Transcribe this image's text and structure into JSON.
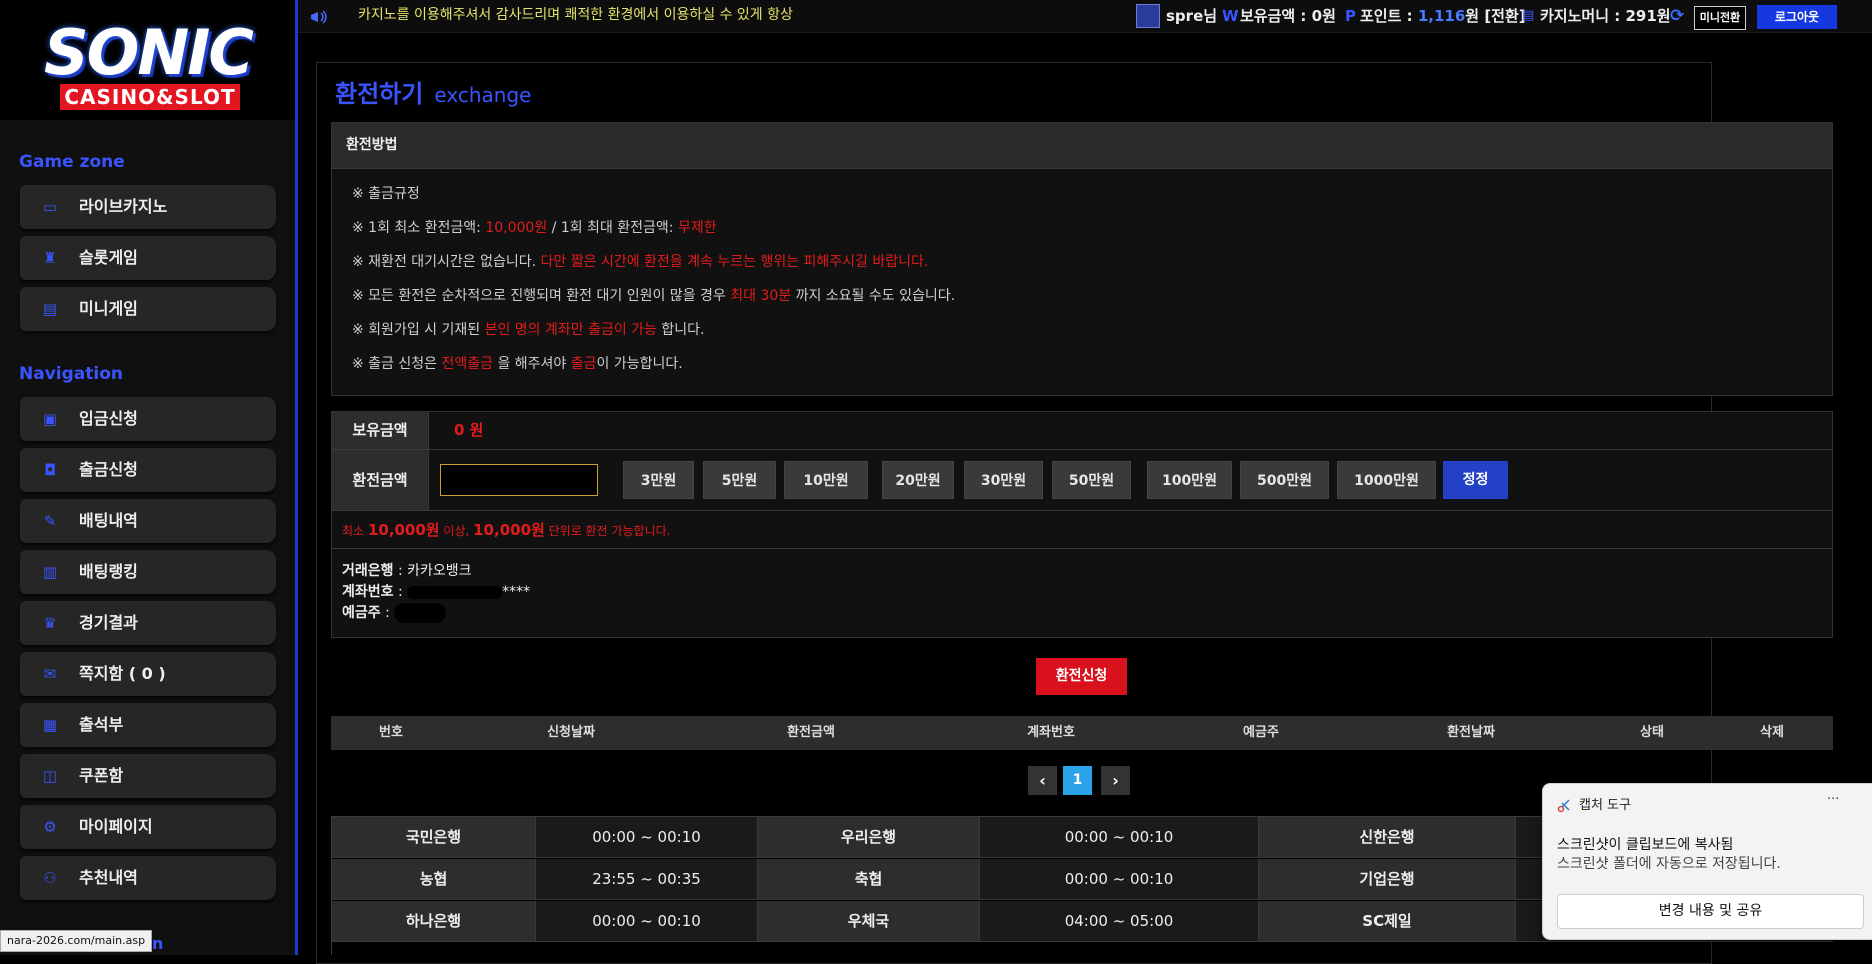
{
  "brand": {
    "logo_main": "SONIC",
    "logo_sub": "CASINO&SLOT"
  },
  "sidebar": {
    "game_heading": "Game zone",
    "game_items": [
      {
        "label": "라이브카지노",
        "icon": "card-icon"
      },
      {
        "label": "슬롯게임",
        "icon": "slot-icon"
      },
      {
        "label": "미니게임",
        "icon": "mini-icon"
      }
    ],
    "nav_heading": "Navigation",
    "nav_items": [
      {
        "label": "입금신청",
        "icon": "deposit-icon"
      },
      {
        "label": "출금신청",
        "icon": "wallet-icon"
      },
      {
        "label": "배팅내역",
        "icon": "history-icon"
      },
      {
        "label": "배팅랭킹",
        "icon": "ranking-icon"
      },
      {
        "label": "경기결과",
        "icon": "trophy-icon"
      },
      {
        "label": "쪽지함 ( 0 )",
        "icon": "message-icon"
      },
      {
        "label": "출석부",
        "icon": "calendar-icon"
      },
      {
        "label": "쿠폰함",
        "icon": "coupon-icon"
      },
      {
        "label": "마이페이지",
        "icon": "gear-icon"
      },
      {
        "label": "추천내역",
        "icon": "user-plus-icon"
      }
    ],
    "cut_heading": "on"
  },
  "topbar": {
    "marquee": "카지노를 이용해주셔서 감사드리며 쾌적한 환경에서 이용하실 수 있게 항상",
    "username": "spre님",
    "balance_label": "보유금액 : 0원",
    "points_label": "포인트 : ",
    "points_value": "1,116",
    "points_suffix": "원 [전환]",
    "casino_label": "카지노머니 : 291원",
    "mini_switch": "미니전환",
    "logout": "로그아웃"
  },
  "page": {
    "title": "환전하기",
    "subtitle": "exchange"
  },
  "method": {
    "heading": "환전방법",
    "rules": [
      {
        "parts": [
          {
            "t": "※ 출금규정",
            "red": false
          }
        ]
      },
      {
        "parts": [
          {
            "t": "※ 1회 최소 환전금액: ",
            "red": false
          },
          {
            "t": "10,000원",
            "red": true
          },
          {
            "t": " / 1회 최대 환전금액: ",
            "red": false
          },
          {
            "t": "무제한",
            "red": true
          }
        ]
      },
      {
        "parts": [
          {
            "t": "※ 재환전 대기시간은 없습니다. ",
            "red": false
          },
          {
            "t": "다만 짧은 시간에 환전을 계속 누르는 행위는 피해주시길 바랍니다.",
            "red": true
          }
        ]
      },
      {
        "parts": [
          {
            "t": "※ 모든 환전은 순차적으로 진행되며 환전 대기 인원이 많을 경우 ",
            "red": false
          },
          {
            "t": "최대 30분",
            "red": true
          },
          {
            "t": " 까지 소요될 수도 있습니다.",
            "red": false
          }
        ]
      },
      {
        "parts": [
          {
            "t": "※ 회원가입 시 기재된 ",
            "red": false
          },
          {
            "t": "본인 명의 계좌만 출금이 가능",
            "red": true
          },
          {
            "t": " 합니다.",
            "red": false
          }
        ]
      },
      {
        "parts": [
          {
            "t": "※ 출금 신청은 ",
            "red": false
          },
          {
            "t": "전액출금",
            "red": true
          },
          {
            "t": " 을 해주셔야 ",
            "red": false
          },
          {
            "t": "출금",
            "red": true
          },
          {
            "t": "이 가능합니다.",
            "red": false
          }
        ]
      }
    ]
  },
  "form": {
    "balance_label": "보유금액",
    "balance_value": "0 원",
    "amount_label": "환전금액",
    "amount_value": "",
    "amount_buttons": [
      "3만원",
      "5만원",
      "10만원",
      "20만원",
      "30만원",
      "50만원",
      "100만원",
      "500만원",
      "1000만원"
    ],
    "reset_button": "정정",
    "notice_prefix": "최소 ",
    "notice_min": "10,000원",
    "notice_mid": " 이상, ",
    "notice_unit": "10,000원",
    "notice_suffix": " 단위로 환전 가능합니다.",
    "bank_label": "거래은행",
    "bank_value": "카카오뱅크",
    "account_label": "계좌번호",
    "account_value": "****",
    "holder_label": "예금주",
    "holder_value": "",
    "submit": "환전신청"
  },
  "history": {
    "columns": [
      "번호",
      "신청날짜",
      "환전금액",
      "계좌번호",
      "예금주",
      "환전날짜",
      "상태",
      "삭제"
    ],
    "page": "1"
  },
  "banks": [
    {
      "name": "국민은행",
      "time": "00:00 ~ 00:10"
    },
    {
      "name": "우리은행",
      "time": "00:00 ~ 00:10"
    },
    {
      "name": "신한은행",
      "time": ""
    },
    {
      "name": "농협",
      "time": "23:55 ~ 00:35"
    },
    {
      "name": "축협",
      "time": "00:00 ~ 00:10"
    },
    {
      "name": "기업은행",
      "time": ""
    },
    {
      "name": "하나은행",
      "time": "00:00 ~ 00:10"
    },
    {
      "name": "우체국",
      "time": "04:00 ~ 05:00"
    },
    {
      "name": "SC제일",
      "time": ""
    }
  ],
  "status_url": "nara-2026.com/main.asp",
  "toast": {
    "app": "캡처 도구",
    "more": "···",
    "title": "스크린샷이 클립보드에 복사됨",
    "body": "스크린샷 폴더에 자동으로 저장됩니다.",
    "action": "변경 내용 및 공유"
  },
  "colors": {
    "accent": "#3a55ff",
    "danger": "#e21b1b",
    "submit": "#d8111c",
    "reset": "#2341c6"
  }
}
